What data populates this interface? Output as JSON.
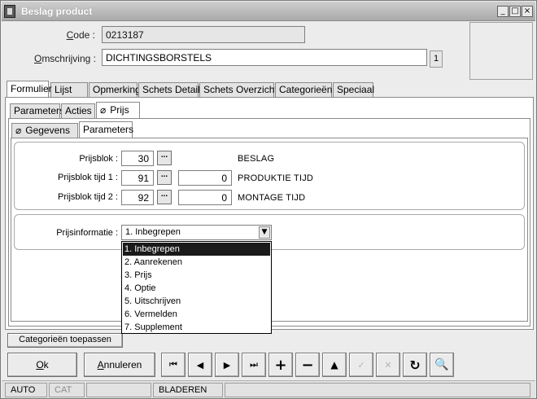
{
  "window": {
    "title": "Beslag product",
    "min": "_",
    "max": "□",
    "close": "×"
  },
  "fields": {
    "code_label_ul": "C",
    "code_label_rest": "ode :",
    "code_value": "0213187",
    "omschrijving_label_ul": "O",
    "omschrijving_label_rest": "mschrijving :",
    "omschrijving_value": "DICHTINGSBORSTELS",
    "counter": "1"
  },
  "tabs_main": [
    "Formulier",
    "Lijst",
    "Opmerking",
    "Schets Detail",
    "Schets Overzicht",
    "Categorieën",
    "Speciaal"
  ],
  "tabs_sub": [
    "Parameters",
    "Acties",
    "Prijs"
  ],
  "tabs_sub2": [
    "Gegevens",
    "Parameters"
  ],
  "pricing": {
    "prijsblok_label": "Prijsblok :",
    "prijsblok_value": "30",
    "prijsblok_caption": "BESLAG",
    "tijd1_label": "Prijsblok tijd 1 :",
    "tijd1_value": "91",
    "tijd1_time": "0",
    "tijd1_caption": "PRODUKTIE TIJD",
    "tijd2_label": "Prijsblok tijd 2 :",
    "tijd2_value": "92",
    "tijd2_time": "0",
    "tijd2_caption": "MONTAGE TIJD",
    "dots": "..."
  },
  "prijsinfo": {
    "label": "Prijsinformatie :",
    "selected": "1.  Inbegrepen",
    "options": [
      "1.  Inbegrepen",
      "2. Aanrekenen",
      "3. Prijs",
      "4. Optie",
      "5. Uitschrijven",
      "6. Vermelden",
      "7. Supplement"
    ]
  },
  "buttons": {
    "categorieen": "Categorieën toepassen",
    "ok_ul": "O",
    "ok_rest": "k",
    "annuleren_ul": "A",
    "annuleren_rest": "nnuleren"
  },
  "nav_icons": {
    "first": "⏮",
    "prev": "◀",
    "next": "▶",
    "last": "⏭",
    "add": "+",
    "remove": "−",
    "up": "▲",
    "check": "✓",
    "cancel": "✕",
    "refresh": "↻",
    "find": "🔍"
  },
  "status": {
    "mode": "AUTO",
    "cat": "CAT",
    "state": "BLADEREN"
  }
}
